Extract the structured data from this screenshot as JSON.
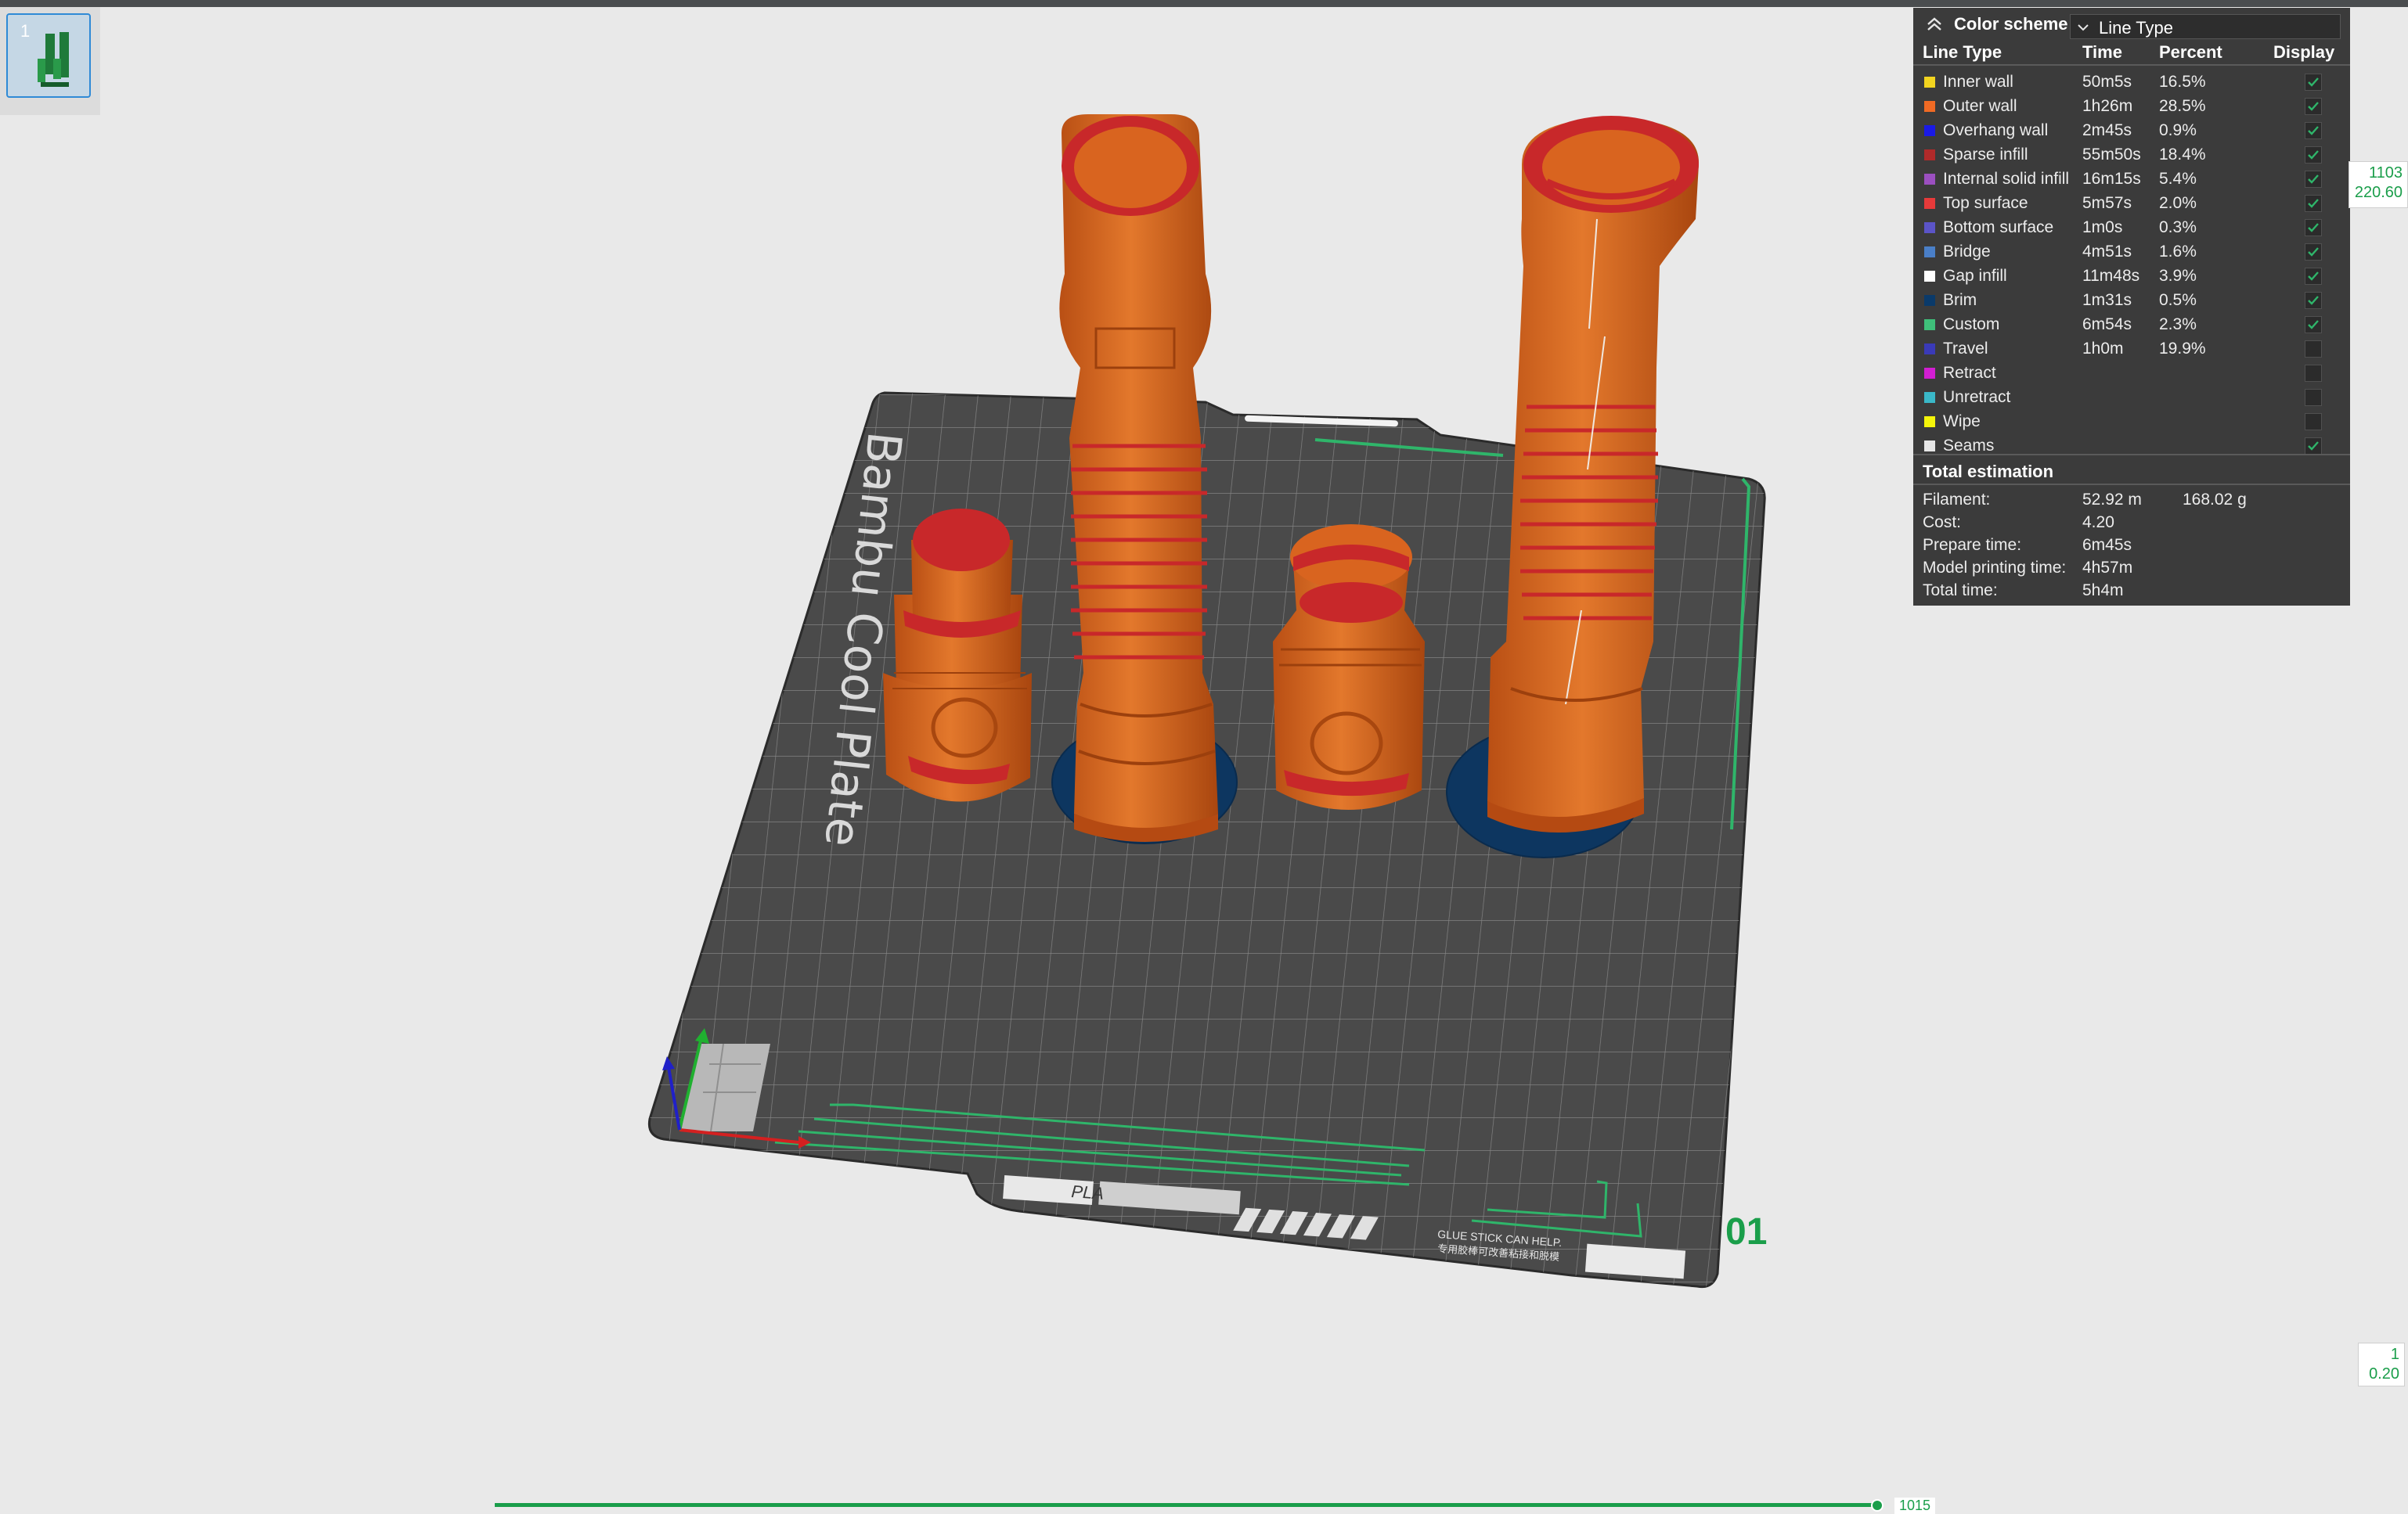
{
  "plate": {
    "thumbnail_index": "1",
    "name": "Bambu Cool Plate",
    "plate_number": "01",
    "material_label": "PLA",
    "glue_notice": "GLUE STICK CAN HELP.",
    "glue_notice_cn": "专用胶棒可改善粘接和脱模"
  },
  "panel": {
    "title": "Color scheme",
    "scheme_value": "Line Type",
    "headers": {
      "line_type": "Line Type",
      "time": "Time",
      "percent": "Percent",
      "display": "Display"
    },
    "rows": [
      {
        "name": "Inner wall",
        "time": "50m5s",
        "percent": "16.5%",
        "color": "#f2d41f",
        "checked": true
      },
      {
        "name": "Outer wall",
        "time": "1h26m",
        "percent": "28.5%",
        "color": "#f06a24",
        "checked": true
      },
      {
        "name": "Overhang wall",
        "time": "2m45s",
        "percent": "0.9%",
        "color": "#1a1ae6",
        "checked": true
      },
      {
        "name": "Sparse infill",
        "time": "55m50s",
        "percent": "18.4%",
        "color": "#b02a2a",
        "checked": true
      },
      {
        "name": "Internal solid infill",
        "time": "16m15s",
        "percent": "5.4%",
        "color": "#9b4fc0",
        "checked": true
      },
      {
        "name": "Top surface",
        "time": "5m57s",
        "percent": "2.0%",
        "color": "#e63a3a",
        "checked": true
      },
      {
        "name": "Bottom surface",
        "time": "1m0s",
        "percent": "0.3%",
        "color": "#5b54c8",
        "checked": true
      },
      {
        "name": "Bridge",
        "time": "4m51s",
        "percent": "1.6%",
        "color": "#4a7fc8",
        "checked": true
      },
      {
        "name": "Gap infill",
        "time": "11m48s",
        "percent": "3.9%",
        "color": "#ffffff",
        "checked": true
      },
      {
        "name": "Brim",
        "time": "1m31s",
        "percent": "0.5%",
        "color": "#0a3a6a",
        "checked": true
      },
      {
        "name": "Custom",
        "time": "6m54s",
        "percent": "2.3%",
        "color": "#3fc07a",
        "checked": true
      },
      {
        "name": "Travel",
        "time": "1h0m",
        "percent": "19.9%",
        "color": "#3a3ab8",
        "checked": false
      },
      {
        "name": "Retract",
        "time": "",
        "percent": "",
        "color": "#d21ed2",
        "checked": false
      },
      {
        "name": "Unretract",
        "time": "",
        "percent": "",
        "color": "#3ab8c8",
        "checked": false
      },
      {
        "name": "Wipe",
        "time": "",
        "percent": "",
        "color": "#f5f50a",
        "checked": false
      },
      {
        "name": "Seams",
        "time": "",
        "percent": "",
        "color": "#e6e6e6",
        "checked": true
      }
    ],
    "total_title": "Total estimation",
    "estimation": [
      {
        "key": "Filament:",
        "value": "52.92 m",
        "value2": "168.02 g"
      },
      {
        "key": "Cost:",
        "value": "4.20",
        "value2": ""
      },
      {
        "key": "Prepare time:",
        "value": "6m45s",
        "value2": ""
      },
      {
        "key": "Model printing time:",
        "value": "4h57m",
        "value2": ""
      },
      {
        "key": "Total time:",
        "value": "5h4m",
        "value2": ""
      }
    ]
  },
  "layer_slider": {
    "top_layer": "1103",
    "top_height": "220.60",
    "bottom_layer": "1",
    "bottom_height": "0.20"
  },
  "move_slider": {
    "value": "1015"
  },
  "colors": {
    "accent": "#1a9e4a",
    "part": "#d9641f",
    "top": "#c8282a"
  }
}
